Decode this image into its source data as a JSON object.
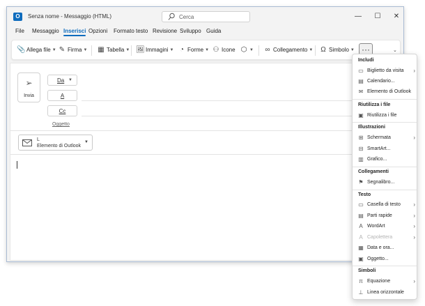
{
  "window": {
    "title": "Senza nome  -  Messaggio (HTML)",
    "search_placeholder": "Cerca",
    "app_icon_letter": "O",
    "controls": {
      "minimize": "—",
      "maximize": "☐",
      "close": "✕"
    }
  },
  "menu_tabs": [
    "File",
    "Messaggio",
    "Inserisci",
    "Opzioni",
    "Formato testo",
    "Revisione",
    "Sviluppo",
    "Guida"
  ],
  "active_tab": "Inserisci",
  "ribbon": {
    "attach_file": "Allega file",
    "signature": "Firma",
    "table": "Tabella",
    "images": "Immagini",
    "shapes": "Forme",
    "icons": "Icone",
    "link": "Collegamento",
    "symbol": "Simbolo",
    "more": "···",
    "collapse": "⌄"
  },
  "compose": {
    "send_label": "Invia",
    "from_label": "Da",
    "to_label": "A",
    "cc_label": "Cc",
    "subject_label": "Oggetto",
    "attachment_line1": "L",
    "attachment_line2": "Elemento di Outlook"
  },
  "dropdown": {
    "includi_head": "Includi",
    "includi_items": [
      "Biglietto da visita",
      "Calendario...",
      "Elemento di Outlook"
    ],
    "riutilizza_head": "Riutilizza i file",
    "riutilizza_items": [
      "Riutilizza i file"
    ],
    "illustrazioni_head": "Illustrazioni",
    "illustrazioni_items": [
      "Schermata",
      "SmartArt...",
      "Grafico..."
    ],
    "collegamenti_head": "Collegamenti",
    "collegamenti_items": [
      "Segnalibro..."
    ],
    "testo_head": "Testo",
    "testo_items": [
      "Casella di testo",
      "Parti rapide",
      "WordArt",
      "Capolettera",
      "Data e ora...",
      "Oggetto..."
    ],
    "simboli_head": "Simboli",
    "simboli_items": [
      "Equazione",
      "Linea orizzontale"
    ]
  },
  "colors": {
    "accent": "#0f6cbd"
  }
}
